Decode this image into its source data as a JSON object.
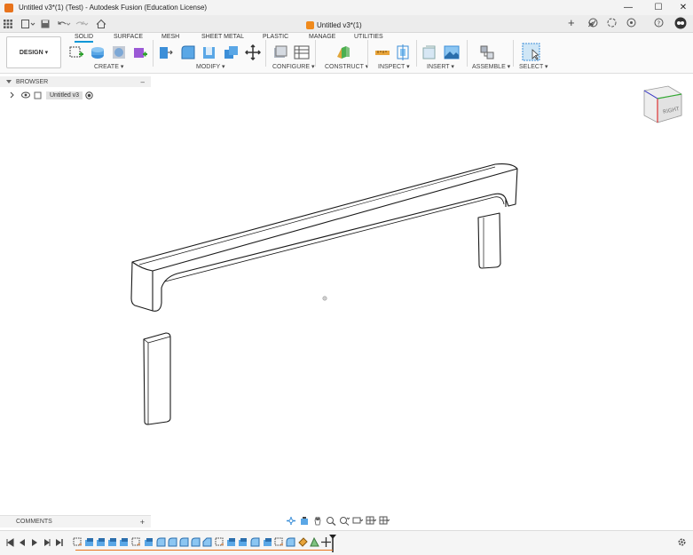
{
  "window": {
    "title": "Untitled v3*(1) (Test) - Autodesk Fusion (Education License)",
    "minimize_glyph": "—",
    "maximize_glyph": "☐",
    "close_glyph": "✕"
  },
  "tabbar": {
    "doc_tab_label": "Untitled v3*(1)",
    "close_glyph": "✕",
    "add_glyph": "+"
  },
  "ribbon": {
    "workspace_label": "DESIGN ▾",
    "tabs": [
      "SOLID",
      "SURFACE",
      "MESH",
      "SHEET METAL",
      "PLASTIC",
      "MANAGE",
      "UTILITIES"
    ],
    "active_tab": "SOLID",
    "groups": [
      "CREATE ▾",
      "MODIFY ▾",
      "CONFIGURE ▾",
      "CONSTRUCT ▾",
      "INSPECT ▾",
      "INSERT ▾",
      "ASSEMBLE ▾",
      "SELECT ▾"
    ]
  },
  "browser": {
    "header": "BROWSER",
    "collapse_glyph": "–",
    "root_item": "Untitled v3"
  },
  "comments": {
    "label": "COMMENTS",
    "add_glyph": "+"
  },
  "viewcube": {
    "face_label": "RIGHT"
  },
  "colors": {
    "accent": "#0696d7",
    "brand": "#e8731c"
  }
}
